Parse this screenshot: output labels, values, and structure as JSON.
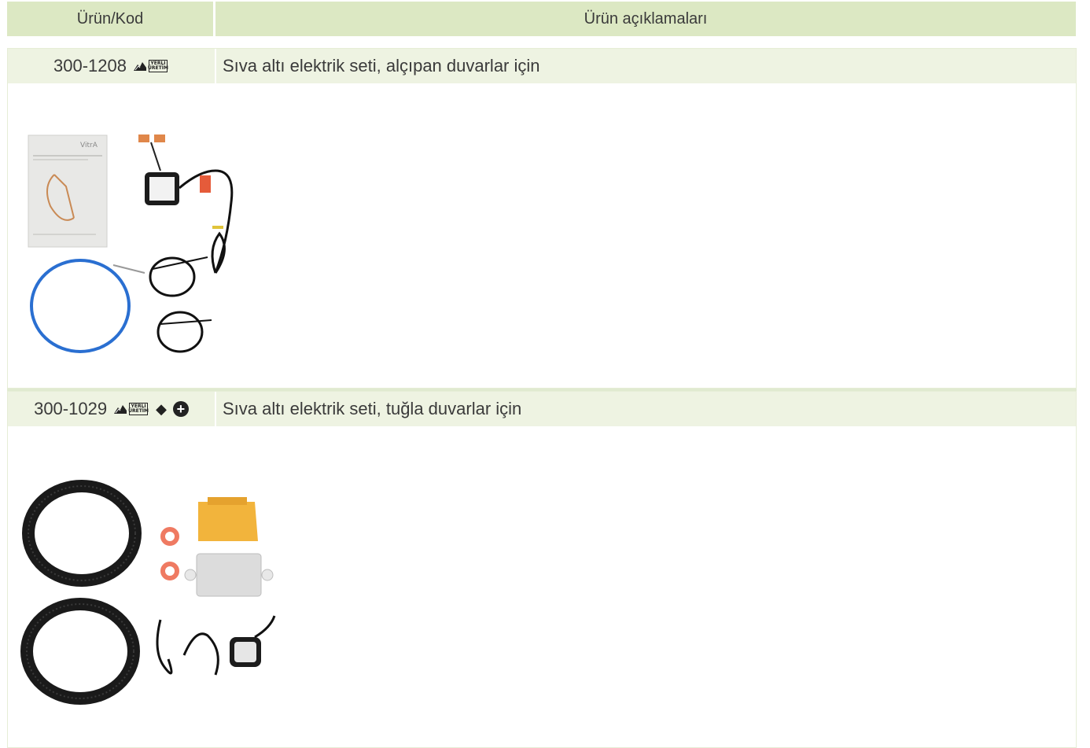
{
  "header": {
    "code_label": "Ürün/Kod",
    "desc_label": "Ürün açıklamaları"
  },
  "products": [
    {
      "code": "300-1208",
      "description": "Sıva altı elektrik seti, alçıpan duvarlar için",
      "badge_top": "YERLİ",
      "badge_bottom": "ÜRETİM",
      "doc_brand": "VitrA"
    },
    {
      "code": "300-1029",
      "description": "Sıva altı elektrik seti, tuğla duvarlar için",
      "badge_top": "YERLİ",
      "badge_bottom": "ÜRETİM",
      "symbol": "◆"
    }
  ],
  "colors": {
    "header_bg": "#dce8c3",
    "row_bg": "#eef3e2"
  }
}
